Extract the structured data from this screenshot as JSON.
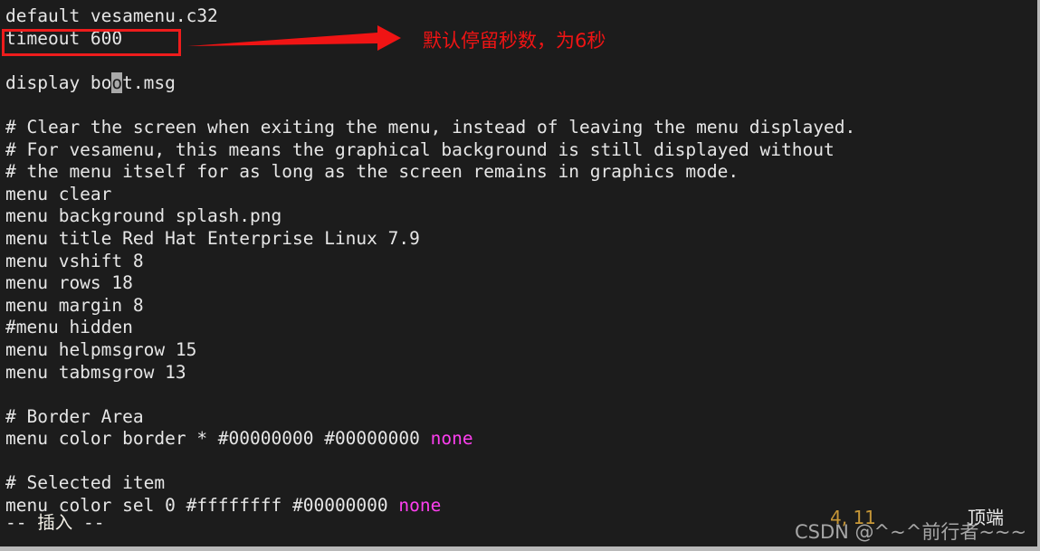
{
  "terminal": {
    "background_color": "#1c1c1c",
    "foreground_color": "#e6e6e6",
    "keyword_color": "#ff3ff0",
    "lines": [
      "default vesamenu.c32",
      "timeout 600",
      "",
      "display boot.msg",
      "",
      "# Clear the screen when exiting the menu, instead of leaving the menu displayed.",
      "# For vesamenu, this means the graphical background is still displayed without",
      "# the menu itself for as long as the screen remains in graphics mode.",
      "menu clear",
      "menu background splash.png",
      "menu title Red Hat Enterprise Linux 7.9",
      "menu vshift 8",
      "menu rows 18",
      "menu margin 8",
      "#menu hidden",
      "menu helpmsgrow 15",
      "menu tabmsgrow 13",
      "",
      "# Border Area",
      "menu color border * #00000000 #00000000 none",
      "",
      "# Selected item",
      "menu color sel 0 #ffffffff #00000000 none"
    ],
    "line_parts": {
      "display_line_pre": "display bo",
      "display_line_cursor": "o",
      "display_line_post": "t.msg",
      "border_line_pre": "menu color border * #00000000 #00000000 ",
      "border_line_kw": "none",
      "sel_line_pre": "menu color sel 0 #ffffffff #00000000 ",
      "sel_line_kw": "none"
    }
  },
  "annotation": {
    "text": "默认停留秒数，为6秒",
    "color": "#f01414",
    "box_color": "#ee1c1c",
    "target_line": "timeout 600"
  },
  "statusbar": {
    "mode": "-- 插入 --",
    "mode_prefix": "-- ",
    "mode_cjk": "插入",
    "mode_suffix": " --",
    "cursor_position": "4, 11",
    "scroll_indicator": "顶端"
  },
  "watermark": {
    "text": "CSDN @^~^前行者~~~"
  }
}
